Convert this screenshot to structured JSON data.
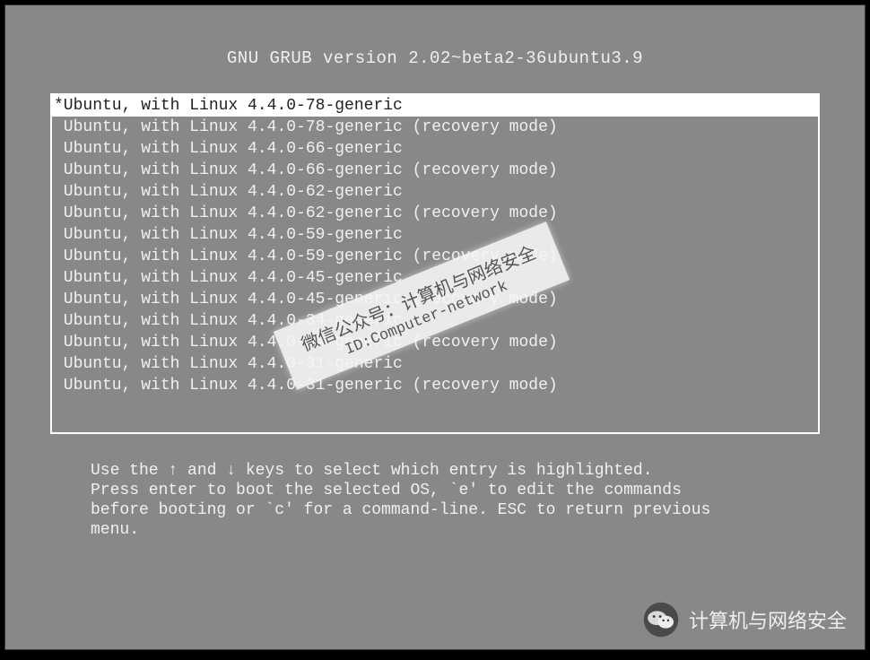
{
  "header": {
    "title": "GNU GRUB  version 2.02~beta2-36ubuntu3.9"
  },
  "menu": {
    "items": [
      {
        "label": "*Ubuntu, with Linux 4.4.0-78-generic",
        "selected": true
      },
      {
        "label": " Ubuntu, with Linux 4.4.0-78-generic (recovery mode)",
        "selected": false
      },
      {
        "label": " Ubuntu, with Linux 4.4.0-66-generic",
        "selected": false
      },
      {
        "label": " Ubuntu, with Linux 4.4.0-66-generic (recovery mode)",
        "selected": false
      },
      {
        "label": " Ubuntu, with Linux 4.4.0-62-generic",
        "selected": false
      },
      {
        "label": " Ubuntu, with Linux 4.4.0-62-generic (recovery mode)",
        "selected": false
      },
      {
        "label": " Ubuntu, with Linux 4.4.0-59-generic",
        "selected": false
      },
      {
        "label": " Ubuntu, with Linux 4.4.0-59-generic (recovery mode)",
        "selected": false
      },
      {
        "label": " Ubuntu, with Linux 4.4.0-45-generic",
        "selected": false
      },
      {
        "label": " Ubuntu, with Linux 4.4.0-45-generic (recovery mode)",
        "selected": false
      },
      {
        "label": " Ubuntu, with Linux 4.4.0-34-generic",
        "selected": false
      },
      {
        "label": " Ubuntu, with Linux 4.4.0-34-generic (recovery mode)",
        "selected": false
      },
      {
        "label": " Ubuntu, with Linux 4.4.0-31-generic",
        "selected": false
      },
      {
        "label": " Ubuntu, with Linux 4.4.0-31-generic (recovery mode)",
        "selected": false
      }
    ]
  },
  "instructions": {
    "text": "Use the ↑ and ↓ keys to select which entry is highlighted.\nPress enter to boot the selected OS, `e' to edit the commands\nbefore booting or `c' for a command-line. ESC to return previous\nmenu."
  },
  "watermark": {
    "line1": "微信公众号：计算机与网络安全",
    "line2": "ID:Computer-network"
  },
  "footer": {
    "brand": "计算机与网络安全"
  }
}
